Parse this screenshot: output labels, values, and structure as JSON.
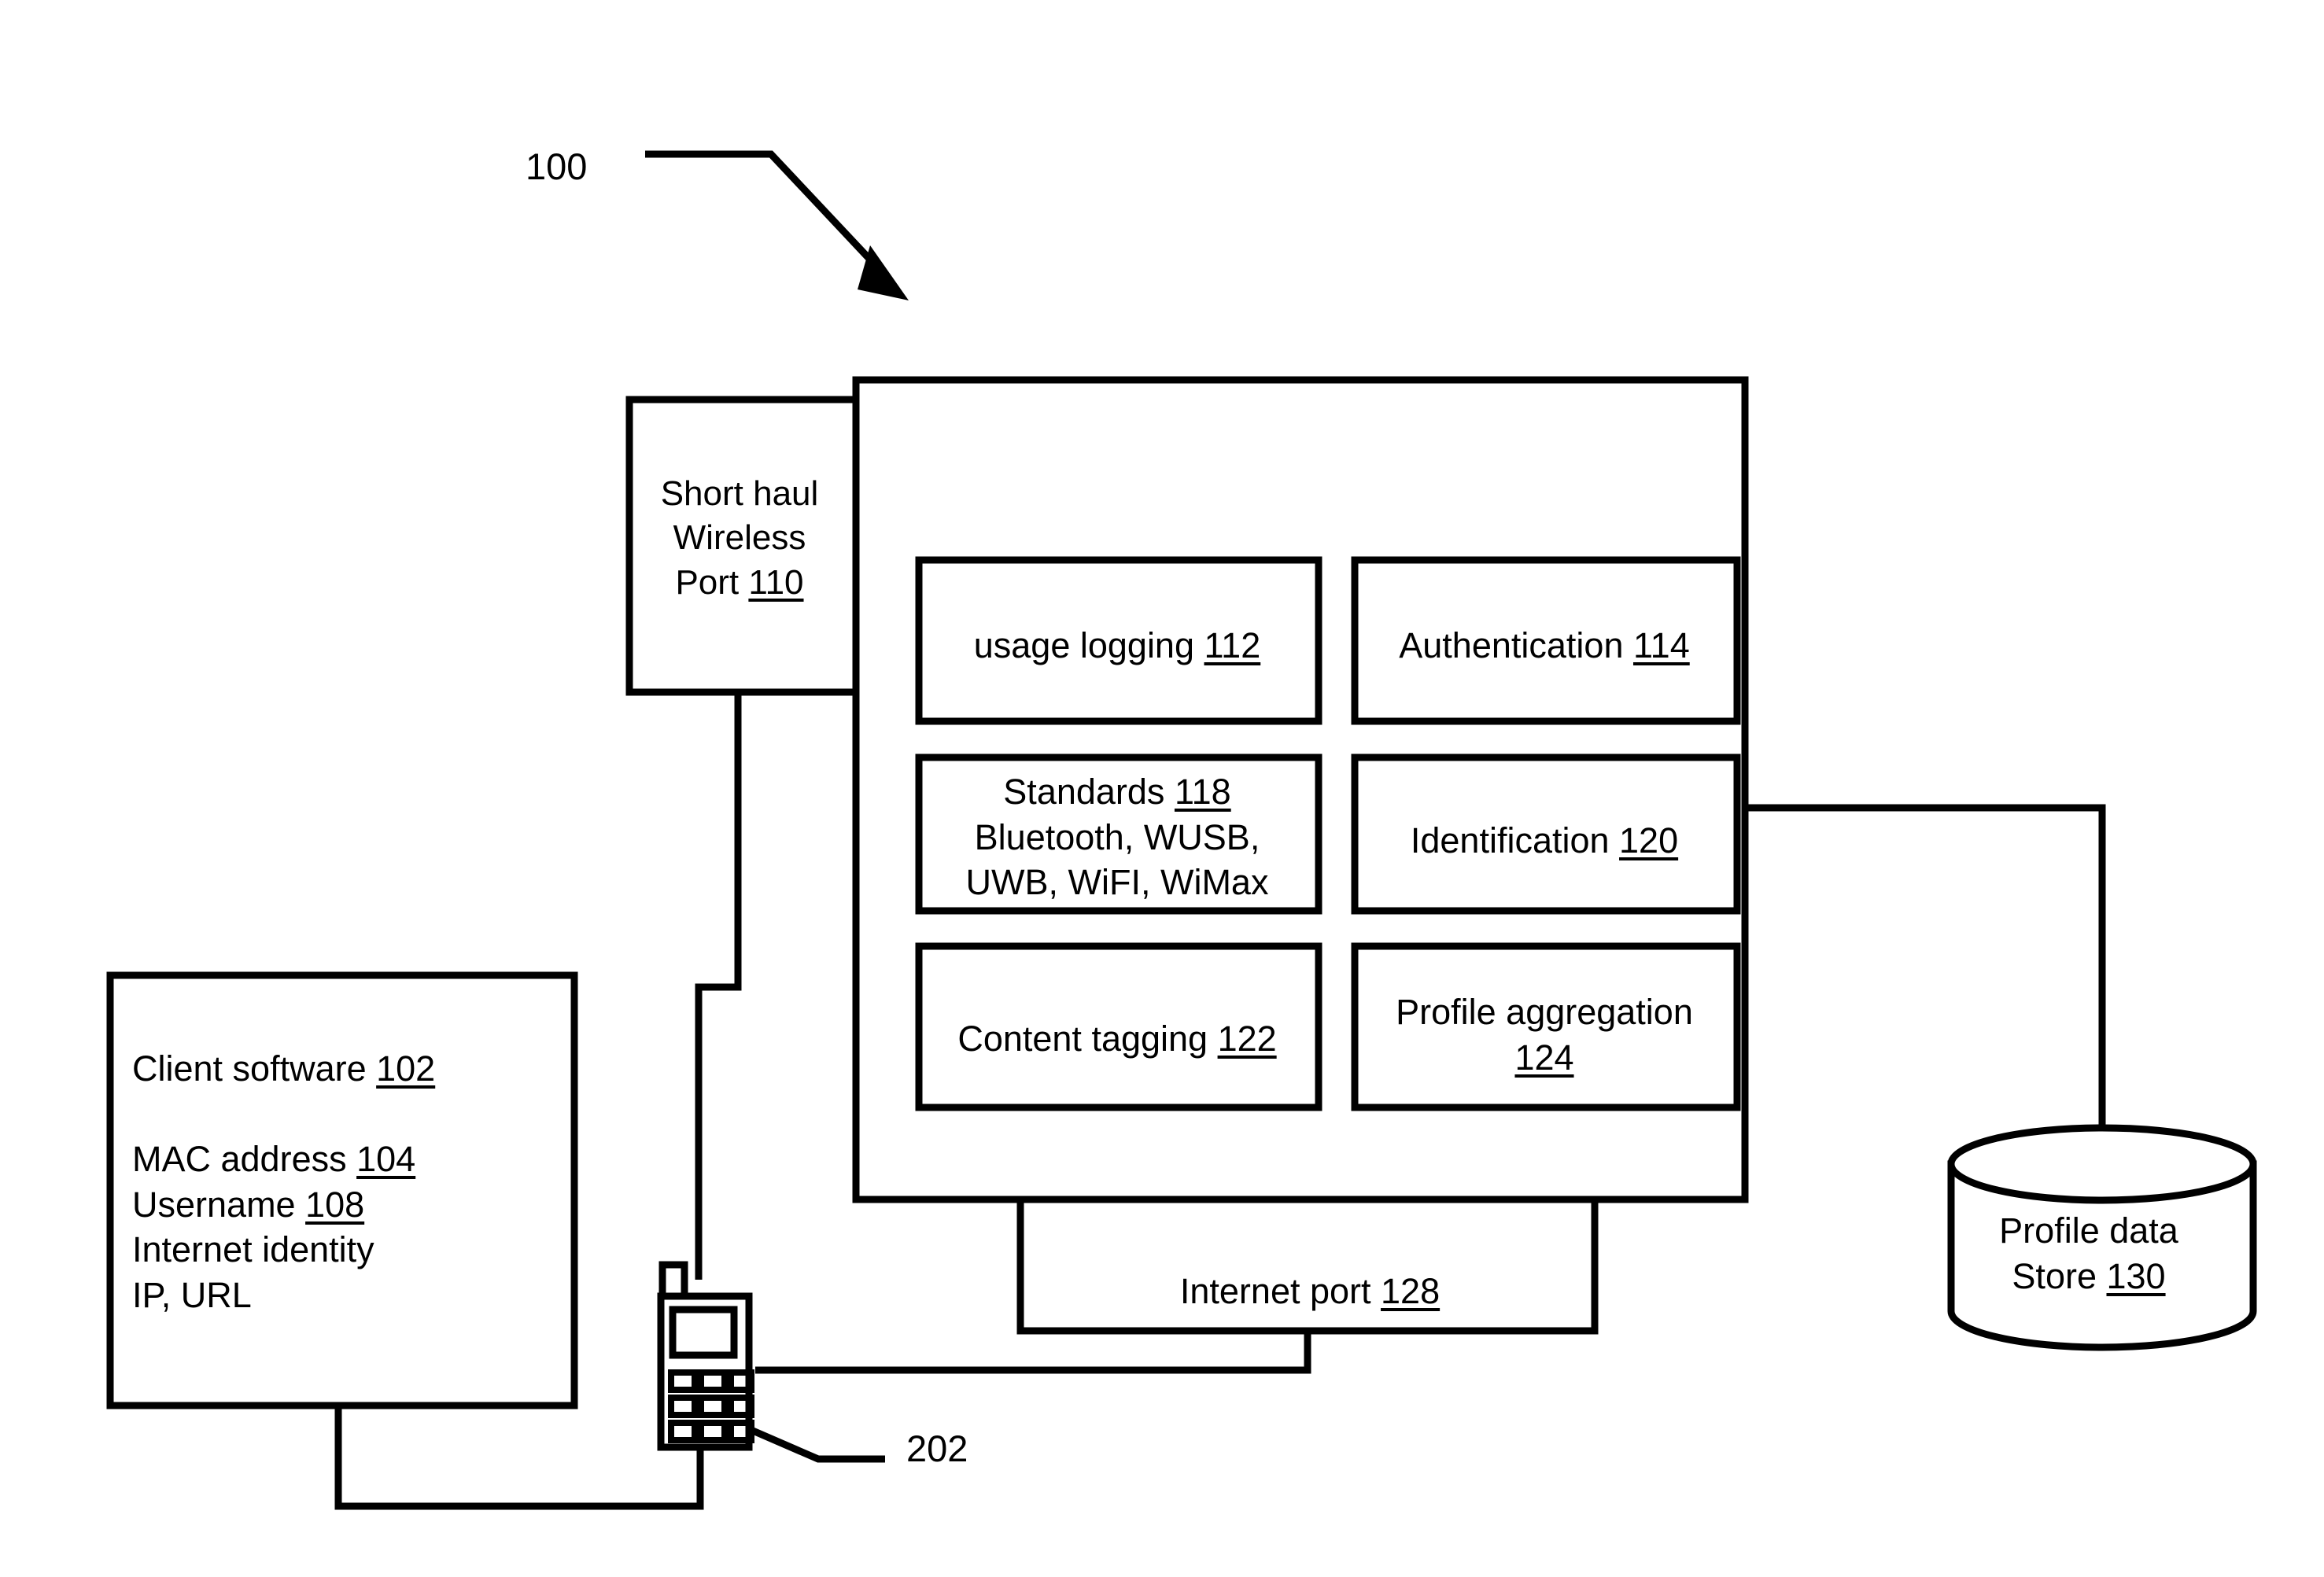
{
  "figure": {
    "reference_numeral": "100",
    "device_reference_numeral": "202"
  },
  "short_haul_port": {
    "line1": "Short haul",
    "line2": "Wireless",
    "line3_text": "Port ",
    "line3_ref": "110"
  },
  "modules": [
    {
      "name": "usage-logging",
      "text": "usage logging ",
      "ref": "112"
    },
    {
      "name": "authentication",
      "text": "Authentication ",
      "ref": "114"
    },
    {
      "name": "standards",
      "text": "Standards ",
      "ref": "118",
      "line2": "Bluetooth, WUSB,",
      "line3": "UWB, WiFI, WiMax"
    },
    {
      "name": "identification",
      "text": "Identification ",
      "ref": "120"
    },
    {
      "name": "content-tagging",
      "text": "Content tagging ",
      "ref": "122"
    },
    {
      "name": "profile-aggregation",
      "text": "Profile aggregation",
      "ref": "124"
    }
  ],
  "internet_port": {
    "text": "Internet port ",
    "ref": "128"
  },
  "client_software": {
    "title_text": "Client software ",
    "title_ref": "102",
    "rows": [
      {
        "text": "MAC address ",
        "ref": "104"
      },
      {
        "text": "Username ",
        "ref": "108"
      },
      {
        "text": "Internet identity",
        "ref": ""
      },
      {
        "text": "IP, URL",
        "ref": ""
      }
    ]
  },
  "profile_store": {
    "line1": "Profile data",
    "line2_text": "Store ",
    "line2_ref": "130"
  },
  "colors": {
    "stroke": "#000000",
    "background": "#ffffff"
  }
}
